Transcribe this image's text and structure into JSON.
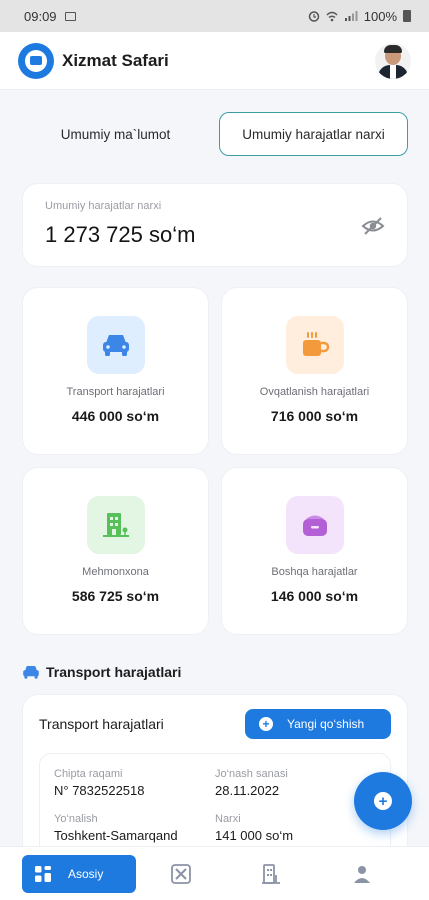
{
  "status_bar": {
    "time": "09:09",
    "battery": "100%"
  },
  "app_bar": {
    "title": "Xizmat Safari"
  },
  "tabs": [
    {
      "label": "Umumiy ma`lumot",
      "active": false
    },
    {
      "label": "Umumiy harajatlar narxi",
      "active": true
    }
  ],
  "total": {
    "label": "Umumiy harajatlar narxi",
    "value": "1 273 725 so‘m"
  },
  "categories": [
    {
      "label": "Transport harajatlari",
      "value": "446 000 so‘m",
      "icon": "car-icon",
      "bg": "#dfeeff",
      "color": "#3b86e6"
    },
    {
      "label": "Ovqatlanish harajatlari",
      "value": "716 000 so‘m",
      "icon": "coffee-icon",
      "bg": "#ffeedd",
      "color": "#f39a3c"
    },
    {
      "label": "Mehmonxona",
      "value": "586 725 so‘m",
      "icon": "hotel-icon",
      "bg": "#e3f6e3",
      "color": "#57c05a"
    },
    {
      "label": "Boshqa harajatlar",
      "value": "146 000 so‘m",
      "icon": "wallet-icon",
      "bg": "#f4e4fb",
      "color": "#b35fd6"
    }
  ],
  "section": {
    "title": "Transport harajatlari"
  },
  "transport_card": {
    "title": "Transport harajatlari",
    "add_label": "Yangi qo‘shish",
    "ticket": {
      "ticket_no_label": "Chipta raqami",
      "ticket_no_value": "N° 7832522518",
      "date_label": "Jo‘nash sanasi",
      "date_value": "28.11.2022",
      "route_label": "Yo‘nalish",
      "route_value": "Toshkent-Samarqand",
      "price_label": "Narxi",
      "price_value": "141 000 so‘m"
    }
  },
  "bottom_nav": {
    "items": [
      {
        "label": "Asosiy",
        "icon": "grid-icon",
        "active": true
      },
      {
        "icon": "tools-icon",
        "active": false
      },
      {
        "icon": "building-icon",
        "active": false
      },
      {
        "icon": "profile-icon",
        "active": false
      }
    ]
  },
  "colors": {
    "primary": "#1f7ae0",
    "tab_border": "#3c9ea5",
    "background": "#f4f6fa"
  }
}
